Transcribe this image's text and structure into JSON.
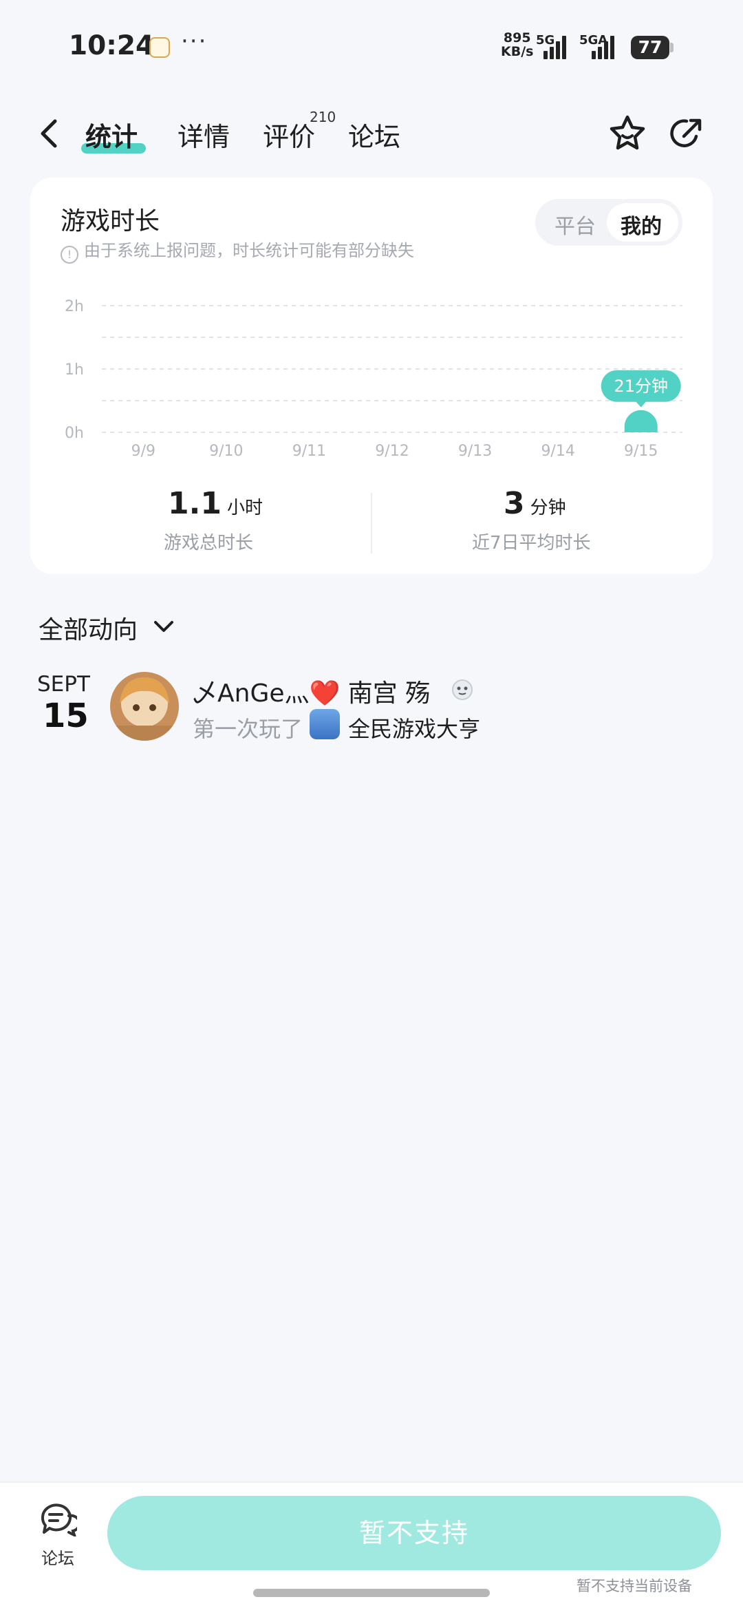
{
  "status_bar": {
    "time": "10:24",
    "net_speed_value": "895",
    "net_speed_unit": "KB/s",
    "sim1_label": "5G",
    "sim2_label": "5GA",
    "battery": "77"
  },
  "header": {
    "tabs": [
      {
        "label": "统计",
        "active": true
      },
      {
        "label": "详情"
      },
      {
        "label": "评价",
        "badge": "210"
      },
      {
        "label": "论坛"
      }
    ]
  },
  "stats": {
    "title": "游戏时长",
    "note": "由于系统上报问题，时长统计可能有部分缺失",
    "toggle": [
      "平台",
      "我的"
    ],
    "total_value": "1.1",
    "total_unit": "小时",
    "total_label": "游戏总时长",
    "avg_value": "3",
    "avg_unit": "分钟",
    "avg_label": "近7日平均时长"
  },
  "chart_data": {
    "type": "bar",
    "categories": [
      "9/9",
      "9/10",
      "9/11",
      "9/12",
      "9/13",
      "9/14",
      "9/15"
    ],
    "values": [
      0,
      0,
      0,
      0,
      0,
      0,
      21
    ],
    "unit": "minutes",
    "y_ticks": [
      "2h",
      "1h",
      "0h"
    ],
    "ylim": [
      0,
      120
    ],
    "tooltip": "21分钟",
    "accent": "#52d2c5"
  },
  "feed": {
    "title": "全部动向",
    "items": [
      {
        "month": "SEPT",
        "day": "15",
        "user": "乄AnGe灬❤️ 南宫 殇",
        "action": "第一次玩了",
        "game": "全民游戏大亨"
      }
    ]
  },
  "bottom_bar": {
    "forum_label": "论坛",
    "cta_label": "暂不支持",
    "cta_note": "暂不支持当前设备"
  },
  "colors": {
    "accent": "#52d2c5",
    "cta_bg": "#a0e9e1",
    "background": "#f5f7fa"
  }
}
